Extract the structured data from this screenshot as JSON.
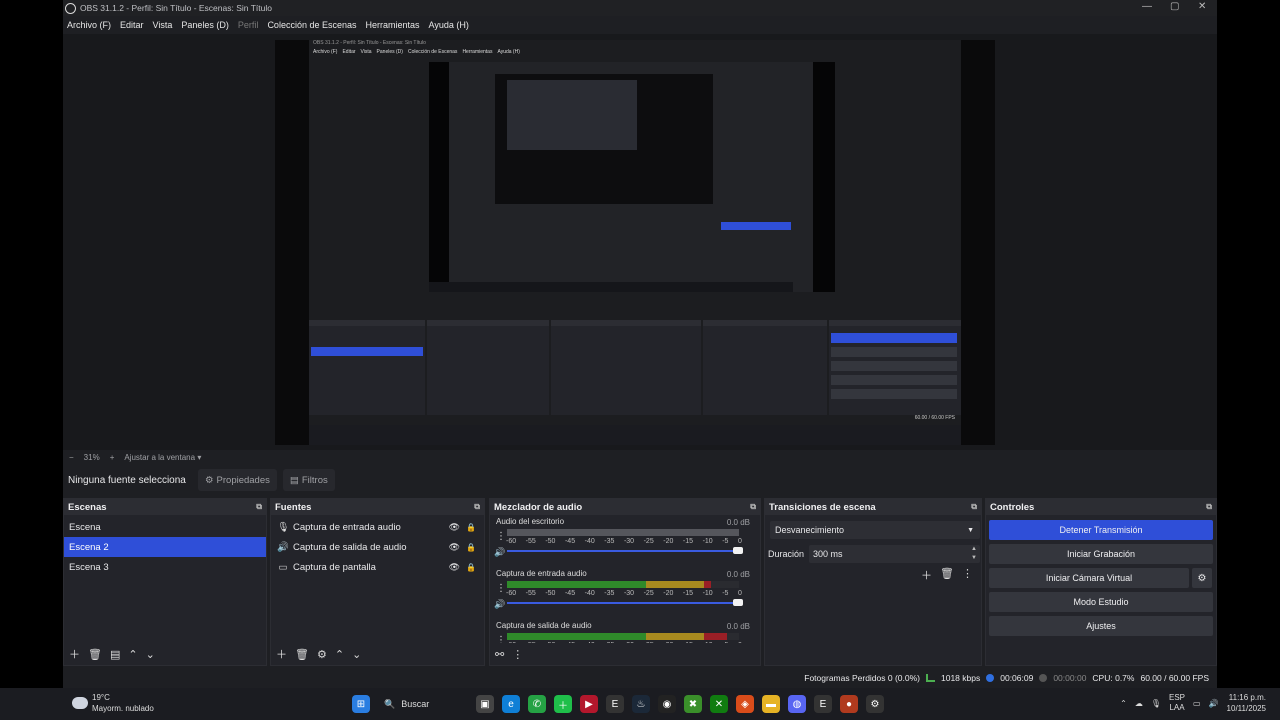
{
  "window": {
    "title": "OBS 31.1.2 - Perfil: Sin Título - Escenas: Sin Título",
    "controls": [
      "—",
      "▢",
      "✕"
    ]
  },
  "menu": [
    "Archivo (F)",
    "Editar",
    "Vista",
    "Paneles (D)",
    "Perfil",
    "Colección de Escenas",
    "Herramientas",
    "Ayuda (H)"
  ],
  "zoom": {
    "minus": "−",
    "value": "31%",
    "plus": "+",
    "fit": "Ajustar a la ventana"
  },
  "source_bar": {
    "label": "Ninguna fuente selecciona",
    "properties": "Propiedades",
    "filters": "Filtros"
  },
  "scenes": {
    "title": "Escenas",
    "items": [
      "Escena",
      "Escena 2",
      "Escena 3"
    ],
    "selected_index": 1
  },
  "sources": {
    "title": "Fuentes",
    "items": [
      {
        "label": "Captura de entrada audio",
        "icon": "microphone-icon"
      },
      {
        "label": "Captura de salida de audio",
        "icon": "speaker-icon"
      },
      {
        "label": "Captura de pantalla",
        "icon": "monitor-icon"
      }
    ]
  },
  "mixer": {
    "title": "Mezclador de audio",
    "ticks": [
      "-60",
      "-55",
      "-50",
      "-45",
      "-40",
      "-35",
      "-30",
      "-25",
      "-20",
      "-15",
      "-10",
      "-5",
      "0"
    ],
    "channels": [
      {
        "name": "Audio del escritorio",
        "db": "0.0 dB",
        "level": 0.0
      },
      {
        "name": "Captura de entrada audio",
        "db": "0.0 dB",
        "level": 0.88
      },
      {
        "name": "Captura de salida de audio",
        "db": "0.0 dB",
        "level": 0.95
      }
    ]
  },
  "transitions": {
    "title": "Transiciones de escena",
    "selected": "Desvanecimiento",
    "duration_label": "Duración",
    "duration_value": "300 ms"
  },
  "controls": {
    "title": "Controles",
    "buttons": [
      "Detener Transmisión",
      "Iniciar Grabación",
      "Iniciar Cámara Virtual",
      "Modo Estudio",
      "Ajustes"
    ]
  },
  "status": {
    "dropped": "Fotogramas Perdidos 0 (0.0%)",
    "bitrate": "1018 kbps",
    "stream_time": "00:06:09",
    "rec_time": "00:00:00",
    "cpu": "CPU: 0.7%",
    "fps": "60.00 / 60.00 FPS"
  },
  "taskbar": {
    "temp": "19°C",
    "weather": "Mayorm. nublado",
    "search": "Buscar",
    "lang1": "ESP",
    "lang2": "LAA",
    "time": "11:16 p.m.",
    "date": "10/11/2025"
  },
  "colors": {
    "accent": "#2f4fd8",
    "meter_green": "#2f8a2a",
    "meter_yellow": "#a88a1f",
    "meter_red": "#9a1f26"
  }
}
